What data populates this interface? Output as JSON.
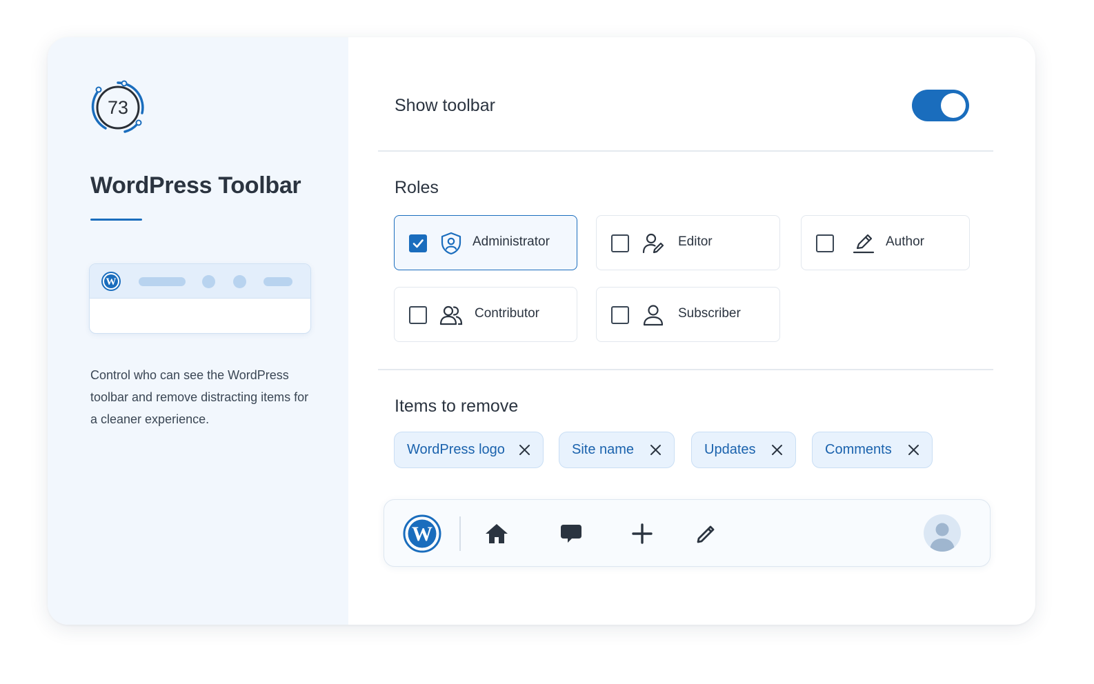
{
  "sidebar": {
    "score": "73",
    "title": "WordPress Toolbar",
    "description": "Control who can see the WordPress toolbar and remove distracting items for a cleaner experience."
  },
  "settings": {
    "show_toolbar_label": "Show toolbar",
    "show_toolbar_enabled": true,
    "roles_title": "Roles",
    "roles": [
      {
        "label": "Administrator",
        "checked": true,
        "icon": "shield-user-icon"
      },
      {
        "label": "Editor",
        "checked": false,
        "icon": "user-edit-icon"
      },
      {
        "label": "Author",
        "checked": false,
        "icon": "pen-icon"
      },
      {
        "label": "Contributor",
        "checked": false,
        "icon": "users-icon"
      },
      {
        "label": "Subscriber",
        "checked": false,
        "icon": "user-icon"
      }
    ],
    "items_title": "Items to remove",
    "items": [
      {
        "label": "WordPress logo"
      },
      {
        "label": "Site name"
      },
      {
        "label": "Updates"
      },
      {
        "label": "Comments"
      }
    ]
  },
  "toolbar_preview": {
    "icons": [
      "wordpress-logo-icon",
      "home-icon",
      "comment-icon",
      "plus-icon",
      "pencil-icon",
      "avatar-icon"
    ]
  },
  "colors": {
    "accent": "#1a6dbd",
    "sidebar_bg": "#f2f7fd",
    "chip_bg": "#e8f2fd",
    "chip_text": "#1a62ad"
  }
}
